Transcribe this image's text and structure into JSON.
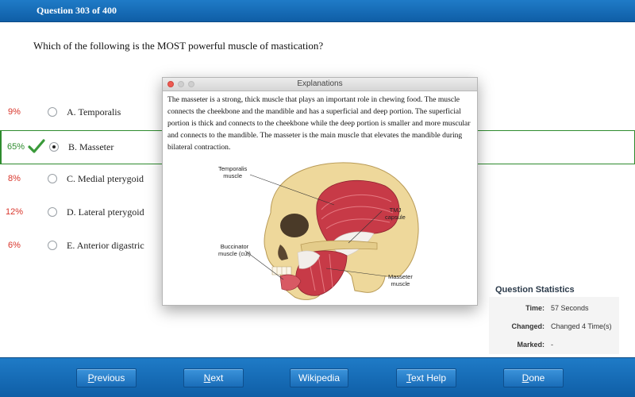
{
  "header": {
    "question_counter": "Question 303 of 400"
  },
  "question": {
    "text": "Which of the following is the MOST powerful muscle of mastication?"
  },
  "answers": [
    {
      "percent": "9%",
      "letter": "A.",
      "text": "Temporalis",
      "selected": false,
      "correct": false
    },
    {
      "percent": "65%",
      "letter": "B.",
      "text": "Masseter",
      "selected": true,
      "correct": true
    },
    {
      "percent": "8%",
      "letter": "C.",
      "text": "Medial pterygoid",
      "selected": false,
      "correct": false
    },
    {
      "percent": "12%",
      "letter": "D.",
      "text": "Lateral pterygoid",
      "selected": false,
      "correct": false
    },
    {
      "percent": "6%",
      "letter": "E.",
      "text": "Anterior digastric",
      "selected": false,
      "correct": false
    }
  ],
  "explanation": {
    "window_title": "Explanations",
    "text": "The masseter is a strong, thick muscle that plays an important role in chewing food. The muscle connects the cheekbone and the mandible and has a superficial and deep portion. The superficial portion is thick and connects to the cheekbone while the deep portion is smaller and more muscular and connects to the mandible. The masseter is the main muscle that elevates the mandible during bilateral contraction.",
    "figure_labels": {
      "temporalis_1": "Temporalis",
      "temporalis_2": "muscle",
      "tmj_1": "TMJ",
      "tmj_2": "capsule",
      "buccinator_1": "Buccinator",
      "buccinator_2": "muscle (cut)",
      "masseter_1": "Masseter",
      "masseter_2": "muscle"
    }
  },
  "statistics": {
    "title": "Question Statistics",
    "time_label": "Time:",
    "time_value": "57 Seconds",
    "changed_label": "Changed:",
    "changed_value": "Changed 4 Time(s)",
    "marked_label": "Marked:",
    "marked_value": "-"
  },
  "footer": {
    "previous": {
      "ul": "P",
      "rest": "revious"
    },
    "next": {
      "ul": "N",
      "rest": "ext"
    },
    "wikipedia": "Wikipedia",
    "text_help": {
      "ul": "T",
      "rest": "ext Help"
    },
    "done": {
      "ul": "D",
      "rest": "one"
    }
  },
  "colors": {
    "bar_blue": "#1671bd",
    "wrong_percent": "#d9352b",
    "correct_green": "#2e8b2e"
  }
}
